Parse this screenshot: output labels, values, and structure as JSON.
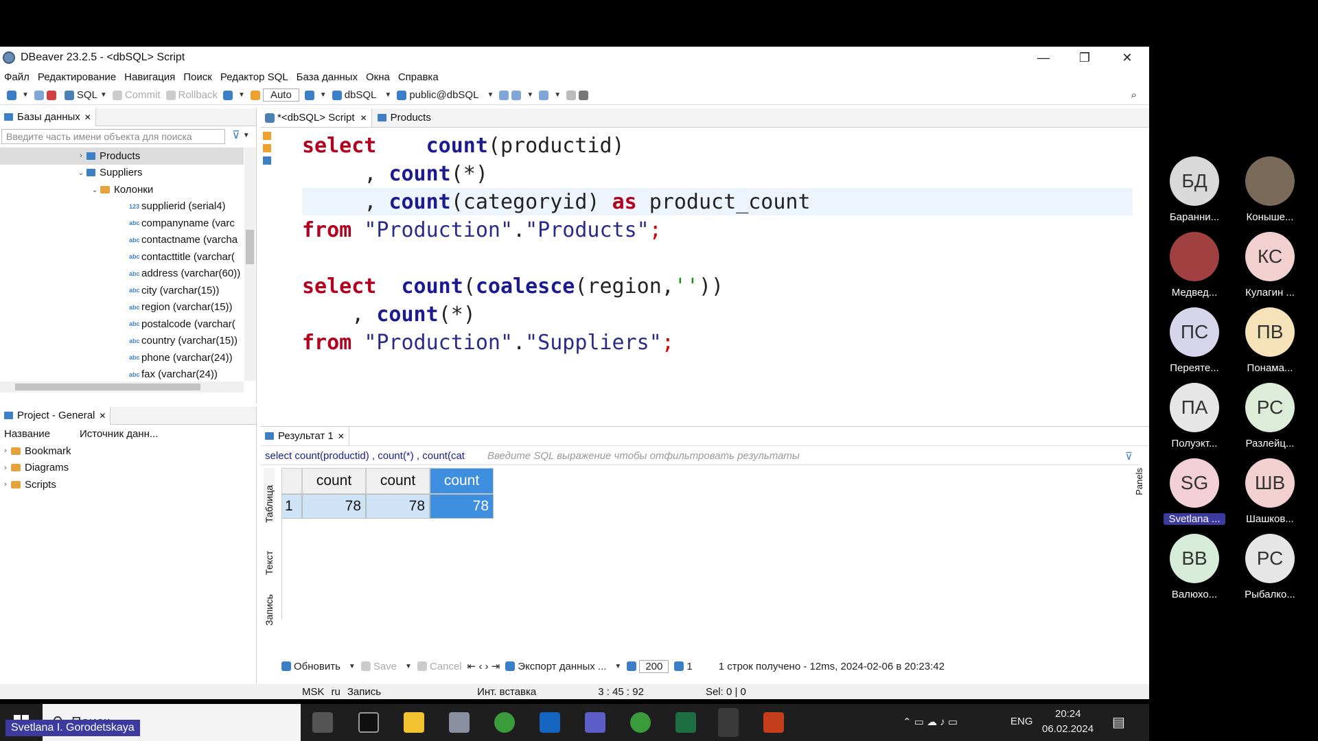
{
  "window": {
    "title": "DBeaver 23.2.5 - <dbSQL> Script",
    "min": "—",
    "max": "❐",
    "close": "✕"
  },
  "menu": [
    "Файл",
    "Редактирование",
    "Навигация",
    "Поиск",
    "Редактор SQL",
    "База данных",
    "Окна",
    "Справка"
  ],
  "toolbar": {
    "sql": "SQL",
    "commit": "Commit",
    "rollback": "Rollback",
    "auto": "Auto",
    "db": "dbSQL",
    "schema": "public@dbSQL"
  },
  "dbpanel": {
    "tab": "Базы данных",
    "search_placeholder": "Введите часть имени объекта для поиска",
    "tree": [
      {
        "label": "Products",
        "kind": "table",
        "level": 1,
        "arrow": "›"
      },
      {
        "label": "Suppliers",
        "kind": "table",
        "level": 1,
        "arrow": "⌄"
      },
      {
        "label": "Колонки",
        "kind": "folder",
        "level": 2,
        "arrow": "⌄"
      },
      {
        "label": "supplierid (serial4)",
        "kind": "col123",
        "level": 3
      },
      {
        "label": "companyname (varc",
        "kind": "colabc",
        "level": 3
      },
      {
        "label": "contactname (varcha",
        "kind": "colabc",
        "level": 3
      },
      {
        "label": "contacttitle (varchar(",
        "kind": "colabc",
        "level": 3
      },
      {
        "label": "address (varchar(60))",
        "kind": "colabc",
        "level": 3
      },
      {
        "label": "city (varchar(15))",
        "kind": "colabc",
        "level": 3
      },
      {
        "label": "region (varchar(15))",
        "kind": "colabc",
        "level": 3
      },
      {
        "label": "postalcode (varchar(",
        "kind": "colabc",
        "level": 3
      },
      {
        "label": "country (varchar(15))",
        "kind": "colabc",
        "level": 3
      },
      {
        "label": "phone (varchar(24))",
        "kind": "colabc",
        "level": 3
      },
      {
        "label": "fax (varchar(24))",
        "kind": "colabc",
        "level": 3
      }
    ]
  },
  "projpanel": {
    "tab": "Project - General",
    "col_name": "Название",
    "col_source": "Источник данн...",
    "items": [
      "Bookmark",
      "Diagrams",
      "Scripts"
    ]
  },
  "editor": {
    "tab_script": "*<dbSQL> Script",
    "tab_products": "Products"
  },
  "results": {
    "tab": "Результат 1",
    "query": "select count(productid) , count(*) , count(cat",
    "filter_placeholder": "Введите SQL выражение чтобы отфильтровать результаты",
    "side_tabs": [
      "Таблица",
      "Текст",
      "Запись"
    ],
    "columns": [
      "count",
      "count",
      "count"
    ],
    "row_num": "1",
    "row": [
      "78",
      "78",
      "78"
    ],
    "refresh": "Обновить",
    "save": "Save",
    "cancel": "Cancel",
    "export": "Экспорт данных ...",
    "limit": "200",
    "fetched_count": "1",
    "status": "1 строк получено - 12ms, 2024-02-06 в 20:23:42",
    "panels": "Panels"
  },
  "statusbar": {
    "tz": "MSK",
    "lang": "ru",
    "mode": "Запись",
    "insert": "Инт. вставка",
    "pos": "3 : 45 : 92",
    "sel": "Sel: 0 | 0"
  },
  "taskbar": {
    "search": "Поиск",
    "lang": "ENG",
    "time": "20:24",
    "date": "06.02.2024"
  },
  "participants": [
    {
      "initials": "БД",
      "name": "Баранни...",
      "color": "#d9d9d9"
    },
    {
      "initials": "",
      "name": "Коныше...",
      "color": "#7a6a5a"
    },
    {
      "initials": "",
      "name": "Медвед...",
      "color": "#a04040"
    },
    {
      "initials": "КС",
      "name": "Кулагин ...",
      "color": "#f3d0d0"
    },
    {
      "initials": "ПС",
      "name": "Переяте...",
      "color": "#d7d5ec"
    },
    {
      "initials": "ПВ",
      "name": "Понама...",
      "color": "#f5e2b8"
    },
    {
      "initials": "ПА",
      "name": "Полуэкт...",
      "color": "#e6e6e6"
    },
    {
      "initials": "РС",
      "name": "Разлейц...",
      "color": "#dcecd8"
    },
    {
      "initials": "SG",
      "name": "Svetlana ...",
      "color": "#f3d0d8"
    },
    {
      "initials": "ШВ",
      "name": "Шашков...",
      "color": "#f3d0d0"
    },
    {
      "initials": "ВВ",
      "name": "Валюхо...",
      "color": "#d6ecd9"
    },
    {
      "initials": "РС",
      "name": "Рыбалко...",
      "color": "#e6e6e6"
    }
  ],
  "presenter": "Svetlana I. Gorodetskaya"
}
